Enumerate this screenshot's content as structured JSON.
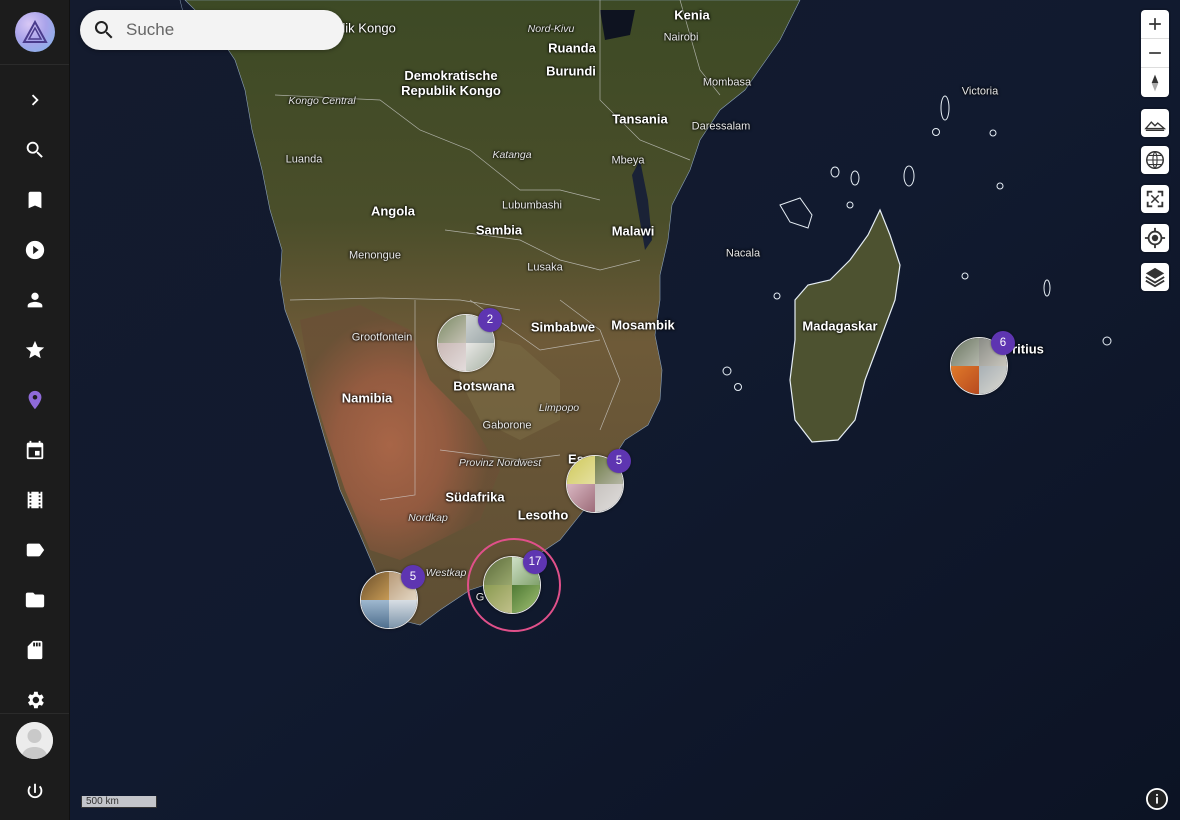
{
  "search": {
    "placeholder": "Suche"
  },
  "sidebar": {
    "items": [
      {
        "name": "expand",
        "icon": "chevron-right-icon"
      },
      {
        "name": "search",
        "icon": "search-icon"
      },
      {
        "name": "bookmarks",
        "icon": "bookmark-icon"
      },
      {
        "name": "videos",
        "icon": "play-circle-icon"
      },
      {
        "name": "people",
        "icon": "person-icon"
      },
      {
        "name": "favorites",
        "icon": "star-icon"
      },
      {
        "name": "places",
        "icon": "map-pin-icon",
        "active": true
      },
      {
        "name": "calendar",
        "icon": "calendar-icon"
      },
      {
        "name": "moments",
        "icon": "film-icon"
      },
      {
        "name": "labels",
        "icon": "label-icon"
      },
      {
        "name": "folders",
        "icon": "folder-icon"
      },
      {
        "name": "library",
        "icon": "sd-card-icon"
      },
      {
        "name": "settings",
        "icon": "gear-icon"
      }
    ],
    "power_icon": "power-icon",
    "active_color": "#8e6ad8"
  },
  "map": {
    "labels": {
      "kongo_top": "Republik Kongo",
      "drc": "Demokratische\nRepublik Kongo",
      "kongo_central": "Kongo Central",
      "nord_kivu": "Nord-Kivu",
      "ruanda": "Ruanda",
      "burundi": "Burundi",
      "kenia": "Kenia",
      "nairobi": "Nairobi",
      "mombasa": "Mombasa",
      "tansania": "Tansania",
      "daressalam": "Daressalam",
      "victoria": "Victoria",
      "luanda": "Luanda",
      "katanga": "Katanga",
      "mbeya": "Mbeya",
      "angola": "Angola",
      "lubumbashi": "Lubumbashi",
      "sambia": "Sambia",
      "malawi": "Malawi",
      "menongue": "Menongue",
      "lusaka": "Lusaka",
      "nacala": "Nacala",
      "grootfontein": "Grootfontein",
      "simbabwe": "Simbabwe",
      "mosambik": "Mosambik",
      "madagaskar": "Madagaskar",
      "mauritius": "ritius",
      "botswana": "Botswana",
      "namibia": "Namibia",
      "limpopo": "Limpopo",
      "gaborone": "Gaborone",
      "provinz_nordwest": "Provinz Nordwest",
      "es": "Es",
      "suedafrika": "Südafrika",
      "nordkap": "Nordkap",
      "lesotho": "Lesotho",
      "westkap": "Westkap",
      "g": "G"
    },
    "clusters": [
      {
        "id": "botswana",
        "count": "2"
      },
      {
        "id": "eswatini",
        "count": "5"
      },
      {
        "id": "cape-town",
        "count": "5"
      },
      {
        "id": "garden-route",
        "count": "17",
        "selected": true
      },
      {
        "id": "mauritius",
        "count": "6"
      }
    ],
    "scale": "500 km",
    "controls": [
      "zoom-in-icon",
      "zoom-out-icon",
      "compass-icon",
      "terrain-icon",
      "globe-icon",
      "fullscreen-icon",
      "locate-icon",
      "layers-icon"
    ]
  },
  "colors": {
    "badge": "#5e35b1",
    "selected_ring": "#e0508a"
  }
}
